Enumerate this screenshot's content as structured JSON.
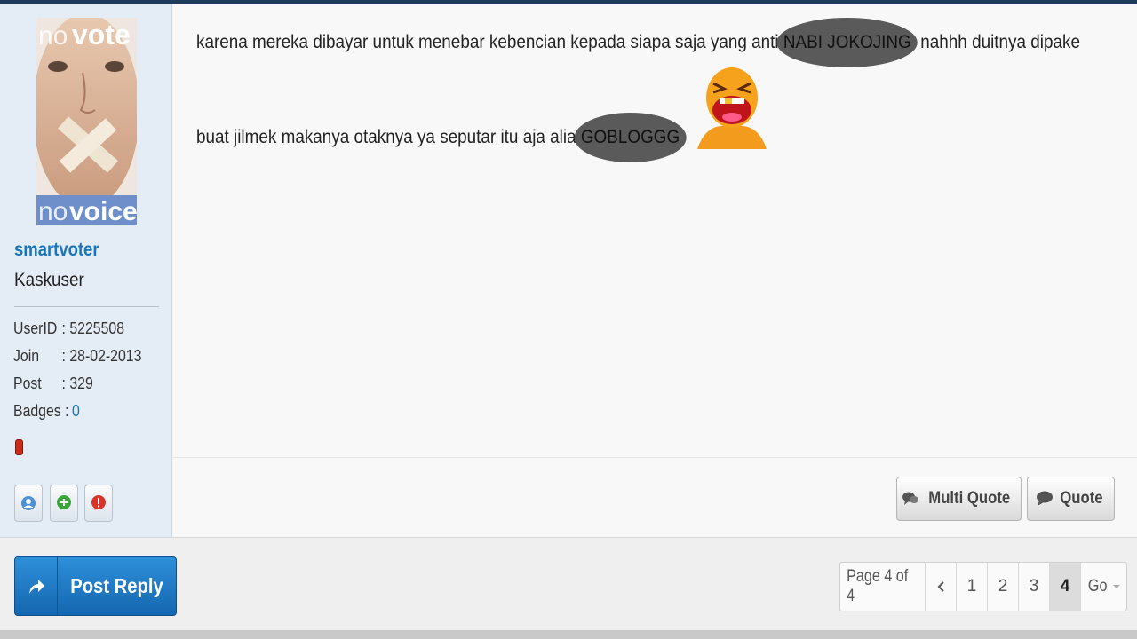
{
  "user": {
    "avatar_top_text_1": "no",
    "avatar_top_text_2": "vote",
    "avatar_bottom_text_1": "no",
    "avatar_bottom_text_2": "voice",
    "username": "smartvoter",
    "rank": "Kaskuser",
    "stats": {
      "userid_label": "UserID",
      "userid_value": ": 5225508",
      "join_label": "Join",
      "join_value": ": 28-02-2013",
      "post_label": "Post",
      "post_value": ": 329",
      "badges_label": "Badges :",
      "badges_value": "0"
    }
  },
  "post": {
    "line1_before": "karena mereka dibayar untuk menebar kebencian kepada siapa saja yang anti ",
    "line1_censored": "NABI JOKOJING",
    "line1_after": ", nahhh duitnya dipake",
    "line2_before": "buat jilmek makanya otaknya ya seputar itu aja alia ",
    "line2_censored": "GOBLOGGG",
    "emoticon": "laughing-emoticon"
  },
  "actions": {
    "multi_quote_label": "Multi Quote",
    "quote_label": "Quote",
    "post_reply_label": "Post Reply"
  },
  "pagination": {
    "info": "Page 4 of 4",
    "pages": [
      "1",
      "2",
      "3",
      "4"
    ],
    "current": "4",
    "go_label": "Go"
  },
  "colors": {
    "link_blue": "#1a74b8",
    "sidebar_bg": "#e4ecf5",
    "button_blue": "#1467b0",
    "censor_gray": "#5a5a5a"
  }
}
